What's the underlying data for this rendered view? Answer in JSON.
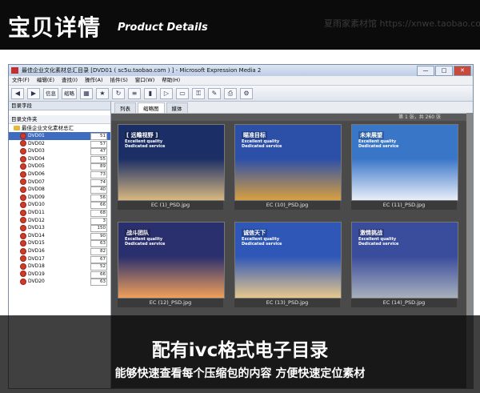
{
  "header": {
    "title_cn": "宝贝详情",
    "title_en": "Product Details",
    "watermark": "夏雨家素材馆 https://xnwe.taobao.com"
  },
  "window": {
    "title": "最佳企业文化素材总汇目录 [DVD01 ( sc5u.taobao.com ) ] - Microsoft Expression Media 2",
    "buttons": [
      "—",
      "□",
      "✕"
    ],
    "menu": [
      "文件(F)",
      "编辑(E)",
      "查找(I)",
      "操作(A)",
      "插件(S)",
      "窗口(W)",
      "帮助(H)"
    ],
    "toolbar": {
      "info": "信息",
      "thumb": "缩略"
    },
    "left": {
      "pane_title": "目录字段",
      "folder_title": "目录文件夹",
      "root": "最佳企业文化素材总汇",
      "items": [
        {
          "label": "DVD01",
          "count": "51"
        },
        {
          "label": "DVD02",
          "count": "57"
        },
        {
          "label": "DVD03",
          "count": "47"
        },
        {
          "label": "DVD04",
          "count": "55"
        },
        {
          "label": "DVD05",
          "count": "89"
        },
        {
          "label": "DVD06",
          "count": "73"
        },
        {
          "label": "DVD07",
          "count": "74"
        },
        {
          "label": "DVD08",
          "count": "40"
        },
        {
          "label": "DVD09",
          "count": "56"
        },
        {
          "label": "DVD10",
          "count": "66"
        },
        {
          "label": "DVD11",
          "count": "68"
        },
        {
          "label": "DVD12",
          "count": "3"
        },
        {
          "label": "DVD13",
          "count": "150"
        },
        {
          "label": "DVD14",
          "count": "90"
        },
        {
          "label": "DVD15",
          "count": "63"
        },
        {
          "label": "DVD16",
          "count": "82"
        },
        {
          "label": "DVD17",
          "count": "67"
        },
        {
          "label": "DVD18",
          "count": "52"
        },
        {
          "label": "DVD19",
          "count": "66"
        },
        {
          "label": "DVD20",
          "count": "63"
        }
      ]
    },
    "tabs": [
      "列表",
      "缩略图",
      "媒体"
    ],
    "status": "第 1 张，共 260 张",
    "thumbs": [
      {
        "file": "EC (1)_PSD.jpg",
        "headline": "[ 远瞻视野 ]",
        "sky": "#1b2f66",
        "ground": "#d8b880"
      },
      {
        "file": "EC (10)_PSD.jpg",
        "headline": "瞄准目标",
        "sky": "#2c4fa8",
        "ground": "#d8a040"
      },
      {
        "file": "EC (11)_PSD.jpg",
        "headline": "未来展望",
        "sky": "#3a76c8",
        "ground": "#e9eef8"
      },
      {
        "file": "EC (12)_PSD.jpg",
        "headline": "战斗团队",
        "sky": "#2a2f6e",
        "ground": "#f0a05a"
      },
      {
        "file": "EC (13)_PSD.jpg",
        "headline": "诚信天下",
        "sky": "#2e57b8",
        "ground": "#e6c88c"
      },
      {
        "file": "EC (14)_PSD.jpg",
        "headline": "激情挑战",
        "sky": "#3a4c9c",
        "ground": "#a8b0bc"
      }
    ],
    "thumb_tagline": [
      "Excellent quality",
      "Dedicated service"
    ]
  },
  "banner": {
    "line1": "配有ivc格式电子目录",
    "line2": "能够快速查看每个压缩包的内容 方便快速定位素材"
  }
}
